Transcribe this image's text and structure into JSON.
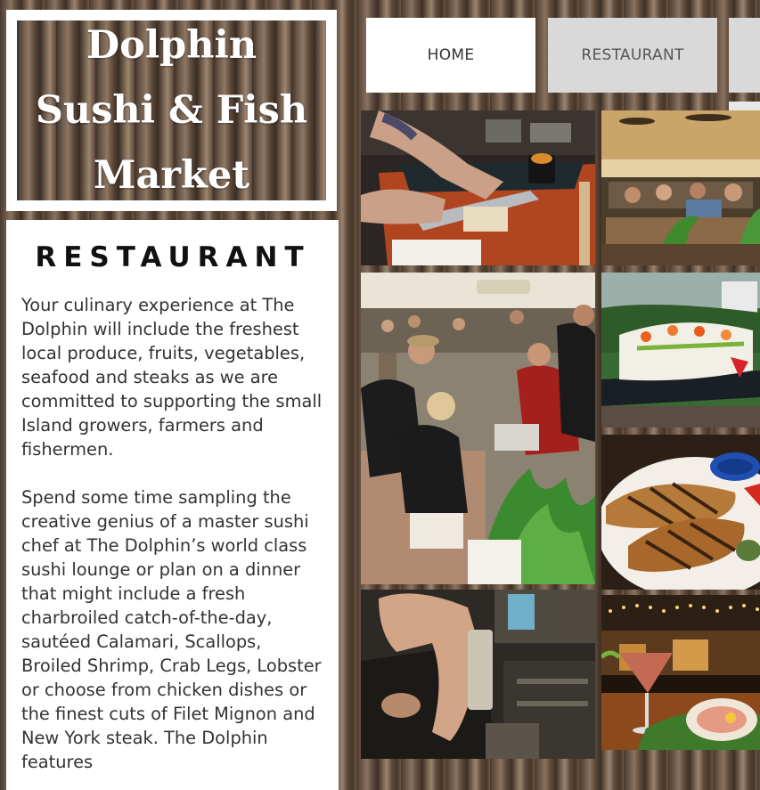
{
  "site": {
    "logo_line1": "Dolphin",
    "logo_line2": "Sushi & Fish",
    "logo_line3": "Market"
  },
  "nav": {
    "home_label": "HOME",
    "restaurant_label": "RESTAURANT"
  },
  "content": {
    "heading": "RESTAURANT",
    "paragraph1": "Your culinary experience at The Dolphin will include the freshest local produce, fruits, vegetables, seafood and steaks as we are committed to supporting the small Island growers, farmers and fishermen.",
    "paragraph2": "Spend some time sampling the creative genius of a master sushi chef at The Dolphin’s world class sushi lounge or plan on a dinner that might include a fresh charbroiled catch-of-the-day, sautéed Calamari, Scallops, Broiled Shrimp, Crab Legs, Lobster or choose from chicken dishes or the finest cuts of Filet Mignon and New York steak. The Dolphin features"
  },
  "gallery": [
    {
      "icon": "sushi-chef-photo"
    },
    {
      "icon": "dining-room-photo"
    },
    {
      "icon": "fish-market-crowd-photo"
    },
    {
      "icon": "sushi-platter-photo"
    },
    {
      "icon": "grilled-fish-photo"
    },
    {
      "icon": "bartender-hand-photo"
    },
    {
      "icon": "cocktail-patio-photo"
    }
  ],
  "colors": {
    "nav_active_bg": "#ffffff",
    "nav_inactive_bg": "#d9d9d9",
    "heading_text": "#111111",
    "body_text": "#333333"
  }
}
